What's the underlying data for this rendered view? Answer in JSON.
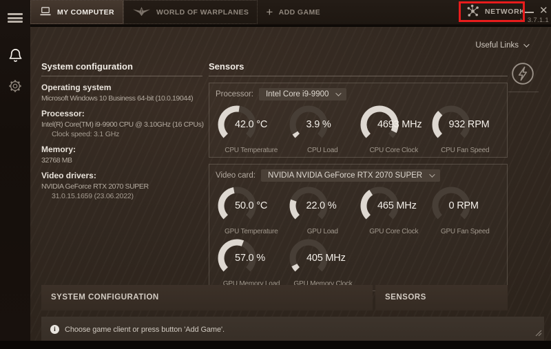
{
  "window": {
    "version": "v. 3.7.1.1"
  },
  "colors": {
    "annotation_red": "#e81c1c",
    "gauge_fill": "#ded8d1",
    "gauge_track": "#473e36",
    "background": "#332921",
    "sidebar": "#150f0b"
  },
  "icons": {
    "hamburger": "menu-icon",
    "bell": "notifications-icon",
    "gear": "settings-icon",
    "laptop": "my-computer-icon",
    "wings": "world-of-warplanes-icon",
    "plus": "add-game-icon",
    "network": "network-icon",
    "bolt": "power-boost-icon",
    "info": "info-icon"
  },
  "tabs": [
    {
      "label": "MY COMPUTER",
      "active": true
    },
    {
      "label": "WORLD OF WARPLANES",
      "active": false
    },
    {
      "label": "ADD GAME",
      "active": false
    }
  ],
  "network": {
    "label": "NETWORK"
  },
  "annotation": {
    "highlight_target": "NETWORK",
    "color": "#e81c1c"
  },
  "useful_links": {
    "label": "Useful Links"
  },
  "system_configuration": {
    "title": "System configuration",
    "footer_label": "SYSTEM CONFIGURATION",
    "sections": [
      {
        "heading": "Operating system",
        "lines": [
          "Microsoft Windows 10 Business 64-bit  (10.0.19044)"
        ],
        "sublines": []
      },
      {
        "heading": "Processor:",
        "lines": [
          "Intel(R) Core(TM) i9-9900 CPU @ 3.10GHz (16 CPUs)"
        ],
        "sublines": [
          "Clock speed: 3.1 GHz"
        ]
      },
      {
        "heading": "Memory:",
        "lines": [
          "32768  MB"
        ],
        "sublines": []
      },
      {
        "heading": "Video drivers:",
        "lines": [
          "NVIDIA GeForce RTX 2070 SUPER"
        ],
        "sublines": [
          "31.0.15.1659  (23.06.2022)"
        ]
      }
    ]
  },
  "sensors": {
    "title": "Sensors",
    "footer_label": "SENSORS",
    "processor_group": {
      "label": "Processor:",
      "selected": "Intel Core i9-9900",
      "gauges": [
        {
          "value": "42.0 °C",
          "label": "CPU Temperature",
          "fraction": 0.53
        },
        {
          "value": "3.9 %",
          "label": "CPU Load",
          "fraction": 0.05
        },
        {
          "value": "4693 MHz",
          "label": "CPU Core Clock",
          "fraction": 0.93
        },
        {
          "value": "932 RPM",
          "label": "CPU Fan Speed",
          "fraction": 0.34
        }
      ]
    },
    "video_group": {
      "label": "Video card:",
      "selected": "NVIDIA NVIDIA GeForce RTX 2070 SUPER",
      "gauges": [
        {
          "value": "50.0 °C",
          "label": "GPU Temperature",
          "fraction": 0.46
        },
        {
          "value": "22.0 %",
          "label": "GPU Load",
          "fraction": 0.24
        },
        {
          "value": "465 MHz",
          "label": "GPU Core Clock",
          "fraction": 0.38
        },
        {
          "value": "0 RPM",
          "label": "GPU Fan Speed",
          "fraction": 0.0
        },
        {
          "value": "57.0 %",
          "label": "GPU Memory Load",
          "fraction": 0.58
        },
        {
          "value": "405 MHz",
          "label": "GPU Memory Clock",
          "fraction": 0.07
        }
      ]
    }
  },
  "status_bar": {
    "message": "Choose game client or press button 'Add Game'."
  }
}
